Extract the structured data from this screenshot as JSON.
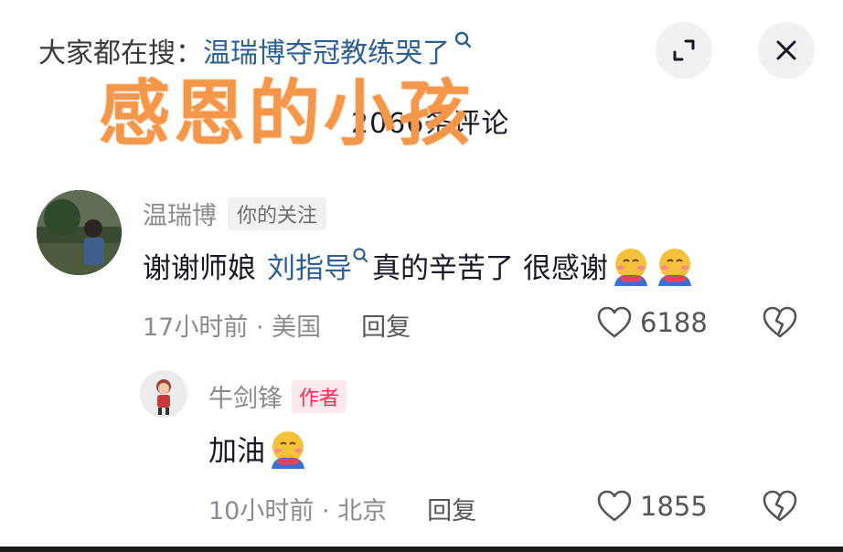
{
  "header": {
    "search_prefix": "大家都在搜：",
    "search_query": "温瑞博夺冠教练哭了",
    "comment_count": "2066条评论",
    "overlay_caption": "感恩的小孩"
  },
  "comments": [
    {
      "nickname": "温瑞博",
      "tag": "你的关注",
      "text_before": "谢谢师娘",
      "mention": "刘指导",
      "text_after": "真的辛苦了 很感谢",
      "time_location": "17小时前 · 美国",
      "reply_label": "回复",
      "likes": "6188"
    },
    {
      "nickname": "牛剑锋",
      "tag": "作者",
      "text": "加油",
      "time_location": "10小时前 · 北京",
      "reply_label": "回复",
      "likes": "1855"
    }
  ],
  "colors": {
    "link_blue": "#2d5f93",
    "overlay_orange": "#f5974b",
    "author_red": "#fe2c55",
    "muted_gray": "#8a8b91"
  },
  "icons": [
    "search-icon",
    "expand-icon",
    "close-icon",
    "heart-icon",
    "broken-heart-icon",
    "hug-emoji-icon"
  ]
}
